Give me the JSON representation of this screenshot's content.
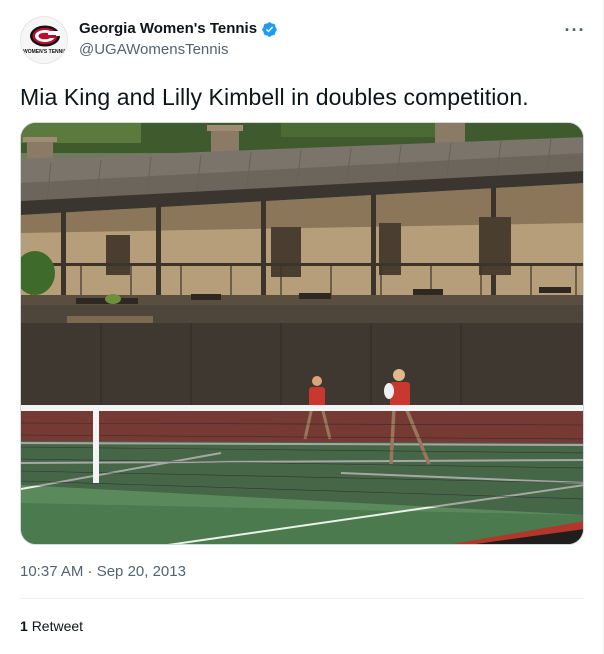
{
  "account": {
    "display_name": "Georgia Women's Tennis",
    "handle": "@UGAWomensTennis",
    "verified": true,
    "avatar_icon": "georgia-g-logo",
    "avatar_text": "WOMEN'S TENNIS"
  },
  "tweet": {
    "text": "Mia King and Lilly Kimbell in doubles competition.",
    "timestamp": "10:37 AM · Sep 20, 2013",
    "media_icon": "tennis-court-photo"
  },
  "stats": {
    "retweets_count": "1",
    "retweets_label": "Retweet"
  },
  "actions": {
    "more_icon": "more-horizontal-icon",
    "more_label": "···"
  },
  "colors": {
    "text_primary": "#0f1419",
    "text_secondary": "#536471",
    "verified": "#1d9bf0",
    "divider": "#eff3f4",
    "georgia_red": "#ba0c2f"
  }
}
